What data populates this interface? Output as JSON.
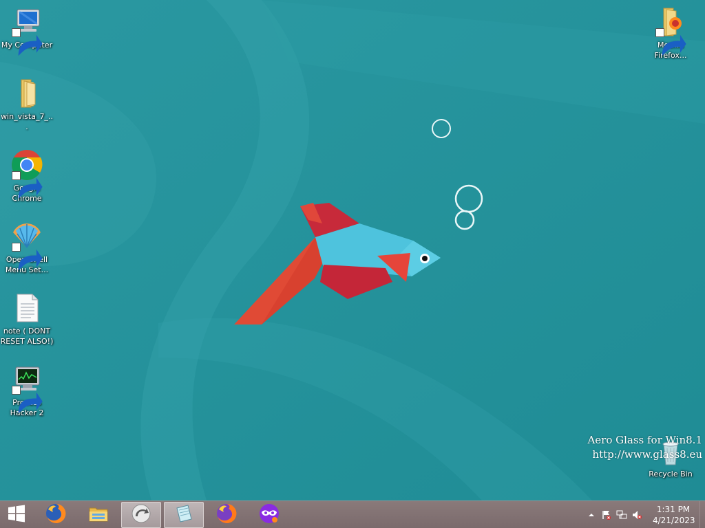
{
  "desktop": {
    "icons": [
      {
        "label": "My Computer",
        "icon": "computer-icon"
      },
      {
        "label": "win_vista_7_...",
        "icon": "folder-icon"
      },
      {
        "label": "Google Chrome",
        "icon": "chrome-icon"
      },
      {
        "label": "Open-Shell Menu Set...",
        "icon": "open-shell-icon"
      },
      {
        "label": "note ( DONT RESET ALSO!)",
        "icon": "text-file-icon"
      },
      {
        "label": "Process Hacker 2",
        "icon": "process-hacker-icon"
      },
      {
        "label": "Mozilla Firefox...",
        "icon": "firefox-folder-icon"
      },
      {
        "label": "Recycle Bin",
        "icon": "recycle-bin-icon"
      }
    ],
    "watermark": {
      "line1": "Aero Glass for Win8.1",
      "line2": "http://www.glass8.eu"
    },
    "wallpaper_color": "#27939c"
  },
  "taskbar": {
    "pinned": [
      {
        "name": "start",
        "icon": "windows-logo-icon"
      },
      {
        "name": "firefox",
        "icon": "firefox-icon"
      },
      {
        "name": "file-explorer",
        "icon": "file-explorer-icon"
      },
      {
        "name": "app-running-1",
        "icon": "circular-arrow-icon"
      },
      {
        "name": "app-running-2",
        "icon": "paper-icon"
      },
      {
        "name": "firefox-nightly",
        "icon": "firefox-icon"
      },
      {
        "name": "privacy-app",
        "icon": "mask-icon"
      }
    ],
    "tray": {
      "icons": [
        "chevron-up-icon",
        "action-center-flag-icon",
        "network-icon",
        "speaker-muted-icon"
      ]
    },
    "clock": {
      "time": "1:31 PM",
      "date": "4/21/2023"
    },
    "color": "#7f6f71"
  }
}
